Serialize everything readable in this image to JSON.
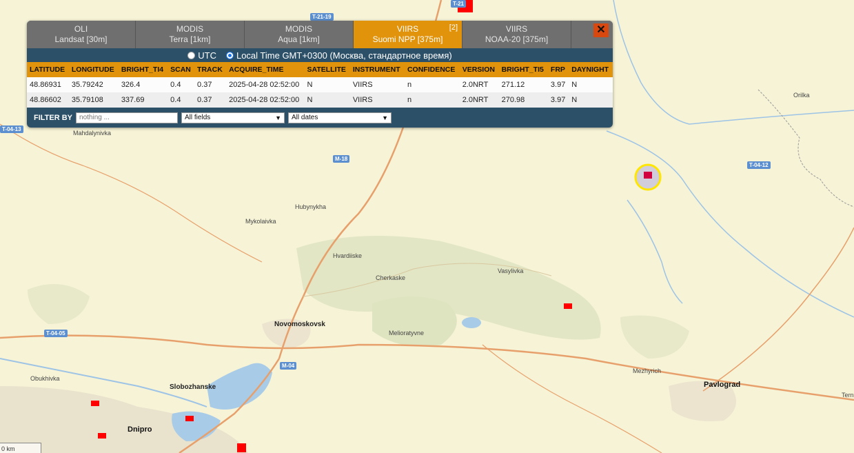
{
  "tabs": [
    {
      "line1": "OLI",
      "line2": "Landsat [30m]",
      "badge": ""
    },
    {
      "line1": "MODIS",
      "line2": "Terra [1km]",
      "badge": ""
    },
    {
      "line1": "MODIS",
      "line2": "Aqua [1km]",
      "badge": ""
    },
    {
      "line1": "VIIRS",
      "line2": "Suomi NPP [375m]",
      "badge": "[2]"
    },
    {
      "line1": "VIIRS",
      "line2": "NOAA-20 [375m]",
      "badge": ""
    }
  ],
  "close_label": "✕",
  "timezone": {
    "utc_label": "UTC",
    "local_label": "Local Time GMT+0300 (Москва, стандартное время)",
    "selected": "local"
  },
  "table": {
    "columns": [
      "LATITUDE",
      "LONGITUDE",
      "BRIGHT_TI4",
      "SCAN",
      "TRACK",
      "ACQUIRE_TIME",
      "SATELLITE",
      "INSTRUMENT",
      "CONFIDENCE",
      "VERSION",
      "BRIGHT_TI5",
      "FRP",
      "DAYNIGHT"
    ],
    "rows": [
      [
        "48.86931",
        "35.79242",
        "326.4",
        "0.4",
        "0.37",
        "2025-04-28 02:52:00",
        "N",
        "VIIRS",
        "n",
        "2.0NRT",
        "271.12",
        "3.97",
        "N"
      ],
      [
        "48.86602",
        "35.79108",
        "337.69",
        "0.4",
        "0.37",
        "2025-04-28 02:52:00",
        "N",
        "VIIRS",
        "n",
        "2.0NRT",
        "270.98",
        "3.97",
        "N"
      ]
    ]
  },
  "filter": {
    "label": "FILTER BY",
    "placeholder": "nothing ...",
    "field_select": "All fields",
    "date_select": "All dates"
  },
  "map": {
    "places": [
      {
        "name": "Mahdalynivka",
        "cls": "place"
      },
      {
        "name": "Hubynykha",
        "cls": "place"
      },
      {
        "name": "Mykolaivka",
        "cls": "place"
      },
      {
        "name": "Hvardiiske",
        "cls": "place"
      },
      {
        "name": "Cherkaske",
        "cls": "place"
      },
      {
        "name": "Vasylivka",
        "cls": "place"
      },
      {
        "name": "Novomoskovsk",
        "cls": "place big"
      },
      {
        "name": "Melioratyvne",
        "cls": "place"
      },
      {
        "name": "Obukhivka",
        "cls": "place"
      },
      {
        "name": "Slobozhanske",
        "cls": "place big"
      },
      {
        "name": "Dnipro",
        "cls": "place city"
      },
      {
        "name": "Mezhyrich",
        "cls": "place"
      },
      {
        "name": "Pavlograd",
        "cls": "place city"
      },
      {
        "name": "Orilka",
        "cls": "place"
      },
      {
        "name": "Tern",
        "cls": "place"
      }
    ],
    "road_shields": [
      "T-21-19",
      "T-04-13",
      "M-18",
      "T-04-12",
      "T-04-05",
      "M-04",
      "T-21"
    ],
    "scale_label": "0 km",
    "colors": {
      "hotspot": "#ff0000",
      "selected_ring": "#ffe600",
      "water": "#a8cbe8",
      "road": "#e7a06b"
    }
  }
}
